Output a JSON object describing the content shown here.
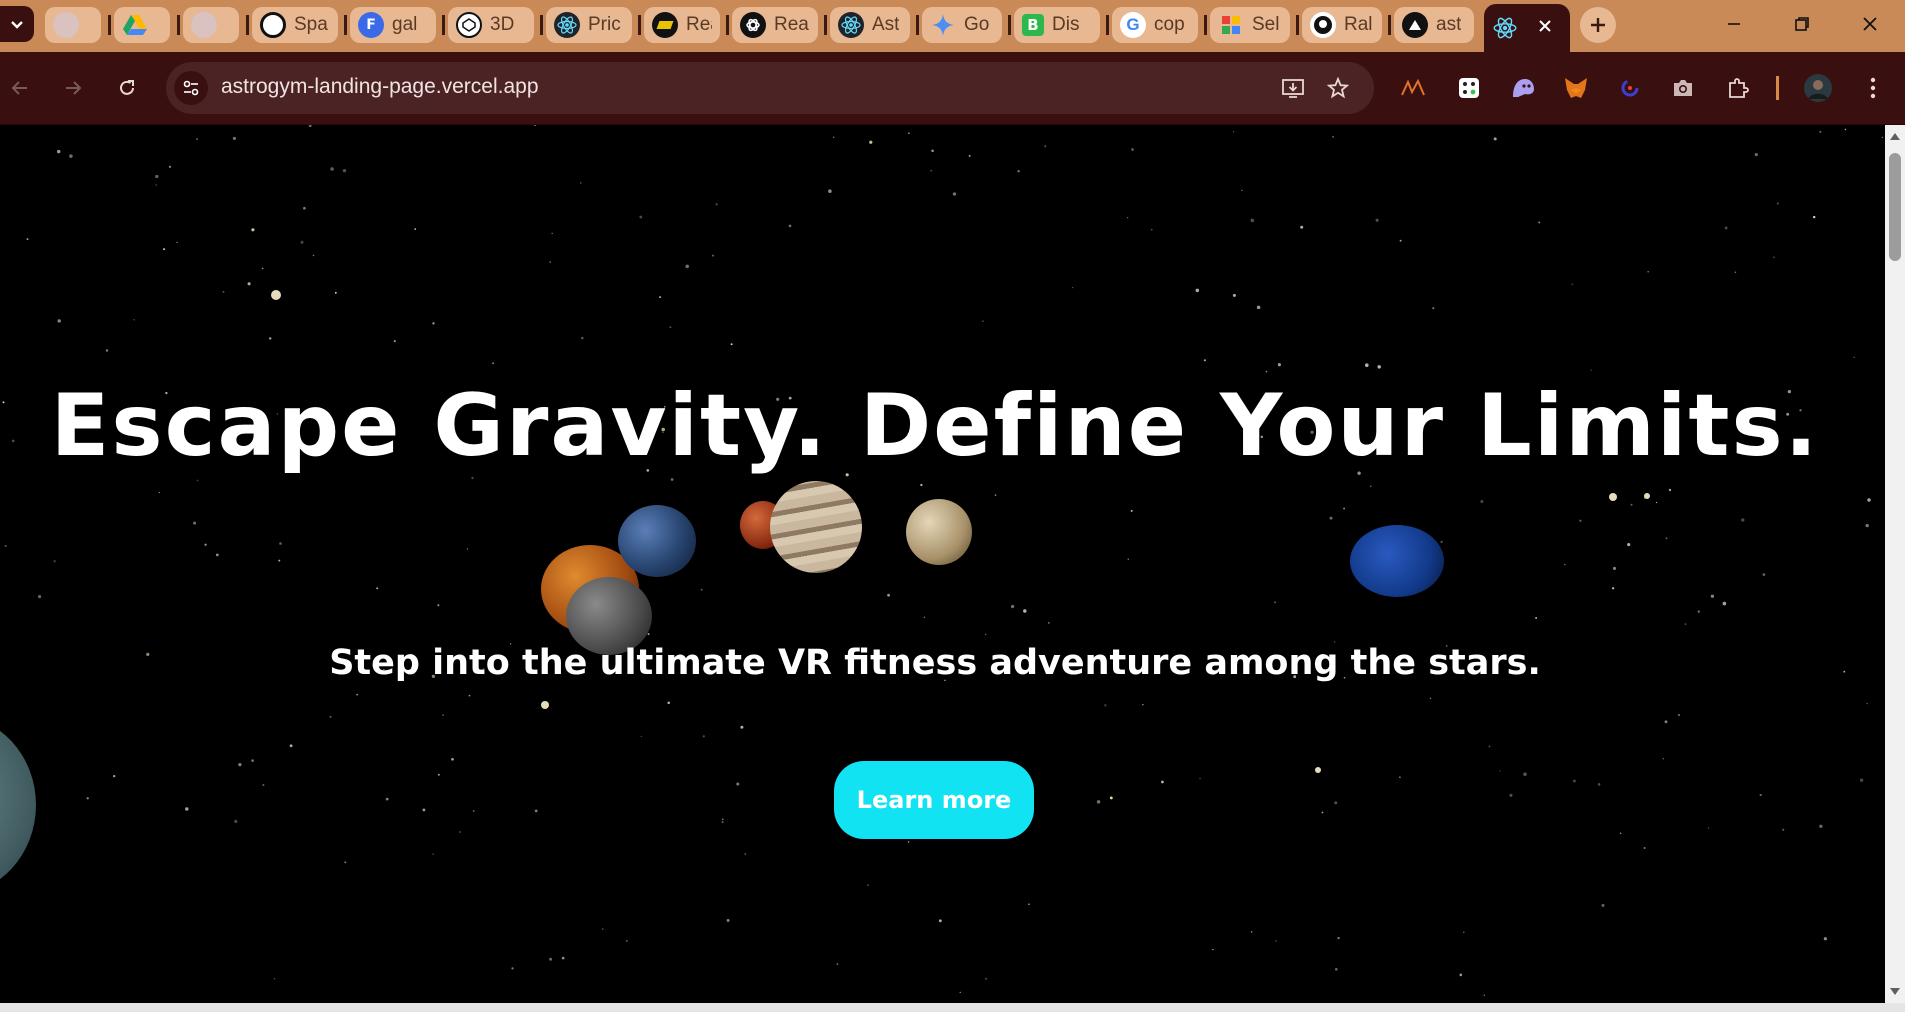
{
  "browser": {
    "tabs": [
      {
        "label": "",
        "icon": "globe-icon",
        "color": "#c7a9a6"
      },
      {
        "label": "",
        "icon": "google-drive-icon",
        "color": "#1fa463"
      },
      {
        "label": "",
        "icon": "globe-icon",
        "color": "#c7a9a6"
      },
      {
        "label": "Spa",
        "icon": "spline-icon",
        "color": "#111111"
      },
      {
        "label": "gal",
        "icon": "framer-icon",
        "color": "#3a6ae8"
      },
      {
        "label": "3D",
        "icon": "codepen-icon",
        "color": "#111111"
      },
      {
        "label": "Pric",
        "icon": "react-icon",
        "color": "#61dafb"
      },
      {
        "label": "Rea",
        "icon": "tabnine-icon",
        "color": "#e8c400"
      },
      {
        "label": "Rea",
        "icon": "openai-icon",
        "color": "#111111"
      },
      {
        "label": "Ast",
        "icon": "react-icon",
        "color": "#61dafb"
      },
      {
        "label": "Go",
        "icon": "gemini-icon",
        "color": "#4c8df6"
      },
      {
        "label": "Dis",
        "icon": "b-icon",
        "color": "#2db84d"
      },
      {
        "label": "cop",
        "icon": "google-icon",
        "color": "#4285f4"
      },
      {
        "label": "Sel",
        "icon": "apps-icon",
        "color": "#e94235"
      },
      {
        "label": "Ral",
        "icon": "github-icon",
        "color": "#111111"
      },
      {
        "label": "ast",
        "icon": "vercel-icon",
        "color": "#111111"
      },
      {
        "label": "",
        "icon": "react-icon",
        "color": "#61dafb",
        "active": true
      }
    ],
    "url": "astrogym-landing-page.vercel.app",
    "accent_color": "#c98a58",
    "toolbar_color": "#3a0f10"
  },
  "page": {
    "title": "Escape Gravity. Define Your Limits.",
    "subtitle": "Step into the ultimate VR fitness adventure among the stars.",
    "cta_label": "Learn more",
    "cta_color": "#12e3f3"
  }
}
